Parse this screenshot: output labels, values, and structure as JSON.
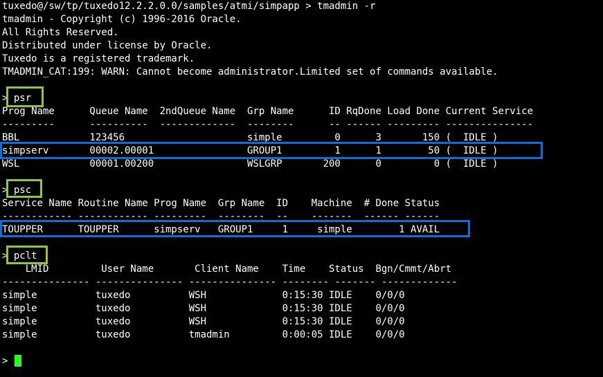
{
  "colors": {
    "background": "#000000",
    "text": "#ffffff",
    "command_highlight": "#8ec63f",
    "row_highlight": "#0a6fd8",
    "cursor": "#22ff22"
  },
  "intro": [
    "tuxedo@/sw/tp/tuxedo12.2.2.0.0/samples/atmi/simpapp > tmadmin -r",
    "tmadmin - Copyright (c) 1996-2016 Oracle.",
    "All Rights Reserved.",
    "Distributed under license by Oracle.",
    "Tuxedo is a registered trademark.",
    "TMADMIN_CAT:199: WARN: Cannot become administrator.Limited set of commands available."
  ],
  "psr": {
    "prompt": "> psr",
    "header": "Prog Name      Queue Name  2ndQueue Name  Grp Name      ID RqDone Load Done Current Service",
    "separator": "---------      ----------  -------------  --------      -- ------ --------- ---------------",
    "rows": [
      "BBL            123456                     simple         0      3       150 (  IDLE )",
      "simpserv       00002.00001                GROUP1         1      1        50 (  IDLE )",
      "WSL            00001.00200                WSLGRP       200      0         0 (  IDLE )"
    ]
  },
  "psc": {
    "prompt": "> psc",
    "header": "Service Name Routine Name Prog Name  Grp Name  ID    Machine  # Done Status",
    "separator": "------------ ------------ ---------  --------  --    -------  ------ ------",
    "rows": [
      "TOUPPER      TOUPPER      simpserv   GROUP1     1     simple        1 AVAIL"
    ]
  },
  "pclt": {
    "prompt": "> pclt",
    "header": "    LMID         User Name       Client Name    Time    Status  Bgn/Cmmt/Abrt",
    "separator": "--------------- --------------- --------------- -------- ------- -------------",
    "rows": [
      "simple          tuxedo          WSH             0:15:30 IDLE    0/0/0",
      "simple          tuxedo          WSH             0:15:30 IDLE    0/0/0",
      "simple          tuxedo          WSH             0:15:30 IDLE    0/0/0",
      "simple          tuxedo          tmadmin         0:00:05 IDLE    0/0/0"
    ]
  },
  "final_prompt": ">"
}
